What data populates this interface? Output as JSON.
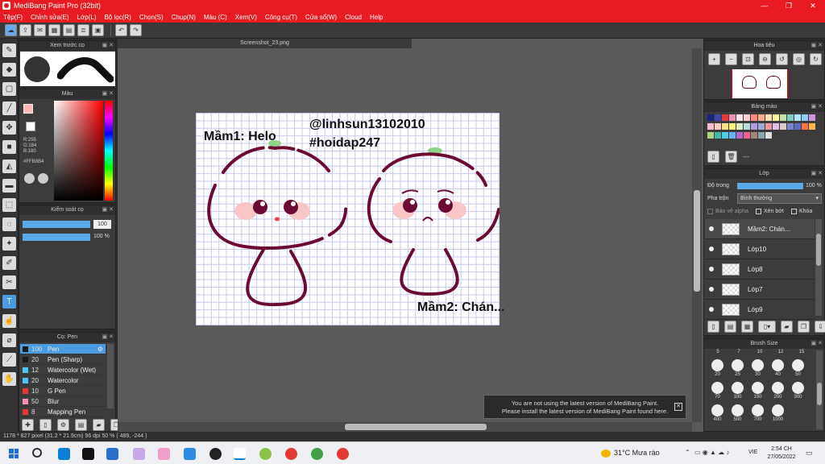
{
  "window": {
    "title": "MediBang Paint Pro (32bit)",
    "minimize": "—",
    "maximize": "❐",
    "close": "✕"
  },
  "menu": [
    "Tệp(F)",
    "Chỉnh sửa(E)",
    "Lớp(L)",
    "Bộ lọc(R)",
    "Chọn(S)",
    "Chụp(N)",
    "Màu (C)",
    "Xem(V)",
    "Công cụ(T)",
    "Cửa sổ(W)",
    "Cloud",
    "Help"
  ],
  "canvas": {
    "tab": "Screenshot_23.png",
    "text1": "Mầm1: Helo",
    "text2": "@linhsun13102010",
    "text3": "#hoidap247",
    "text4": "Mầm2: Chán..."
  },
  "panels": {
    "brush_preview": "Xem trước cọ",
    "color": "Màu",
    "color_values": {
      "r": "R:255",
      "g": "G:184",
      "b": "B:180",
      "hex": "#FFB8B4"
    },
    "brush_control": "Kiểm soát cọ",
    "brush_size_value": "100",
    "brush_opacity_value": "100 %",
    "brush_list": "Cọ: Pen",
    "navigator": "Hoa tiêu",
    "palette": "Bảng màu",
    "palette_dash": "---",
    "layer": "Lớp",
    "opacity_label": "Độ trong",
    "opacity_value": "100 %",
    "blend_label": "Pha trộn",
    "blend_value": "Bình thường",
    "protect_alpha": "Bảo vệ alpha",
    "clipping": "Xén bớt",
    "lock": "Khóa",
    "brush_size_panel": "Brush Size"
  },
  "brushes": [
    {
      "size": "100",
      "name": "Pen",
      "color": "#1a1a1a",
      "selected": true
    },
    {
      "size": "20",
      "name": "Pen (Sharp)",
      "color": "#1a1a1a",
      "selected": false
    },
    {
      "size": "12",
      "name": "Watercolor (Wet)",
      "color": "#4fc3f7",
      "selected": false
    },
    {
      "size": "20",
      "name": "Watercolor",
      "color": "#4fc3f7",
      "selected": false
    },
    {
      "size": "10",
      "name": "G Pen",
      "color": "#e53935",
      "selected": false
    },
    {
      "size": "50",
      "name": "Blur",
      "color": "#f48fb1",
      "selected": false
    },
    {
      "size": "8",
      "name": "Mapping Pen",
      "color": "#e53935",
      "selected": false
    }
  ],
  "layers": [
    "Mầm2: Chán...",
    "Lớp10",
    "Lớp8",
    "Lớp7",
    "Lớp9"
  ],
  "size_header": [
    "5",
    "7",
    "10",
    "12",
    "15"
  ],
  "size_rows": [
    [
      "20",
      "25",
      "30",
      "40",
      "50"
    ],
    [
      "70",
      "100",
      "150",
      "200",
      "300"
    ],
    [
      "400",
      "500",
      "700",
      "1000"
    ]
  ],
  "notice": {
    "line1": "You are not using the latest version of MediBang Paint.",
    "line2": "Please install the latest version of MediBang Paint found here."
  },
  "status": "1178 * 827 pixel   (31.2 * 21.9cm)   96 dpi   50 %   ( 489, -244 )",
  "taskbar": {
    "weather": "31°C  Mưa rào",
    "lang": "VIE",
    "time": "2:54 CH",
    "date": "27/05/2022"
  }
}
